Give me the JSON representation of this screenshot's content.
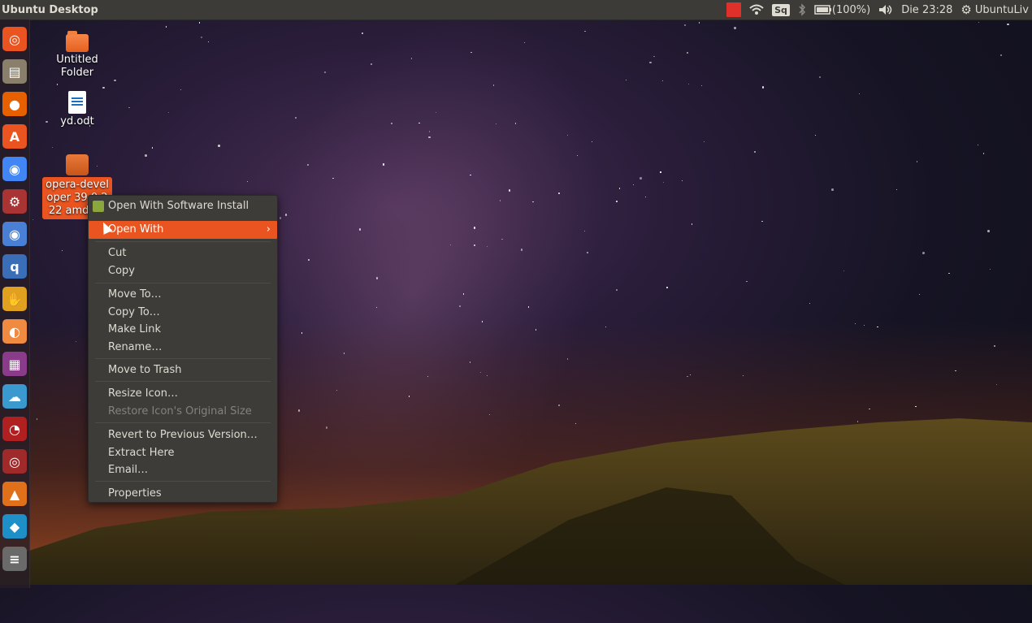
{
  "panel": {
    "title": "Ubuntu Desktop",
    "battery": "(100%)",
    "clock": "Die 23:28",
    "user": "UbuntuLiv",
    "indicator_sq": "Sq"
  },
  "desktop_icons": [
    {
      "label": "Untitled Folder",
      "type": "folder"
    },
    {
      "label": "yd.odt",
      "type": "document"
    },
    {
      "label": "opera-developer 39.0.222 amd64.",
      "type": "package"
    }
  ],
  "context_menu": {
    "items": [
      {
        "label": "Open With Software Install"
      },
      {
        "label": "Open With",
        "submenu": true,
        "highlighted": true
      },
      {
        "label": "Cut"
      },
      {
        "label": "Copy"
      },
      {
        "label": "Move To…"
      },
      {
        "label": "Copy To…"
      },
      {
        "label": "Make Link"
      },
      {
        "label": "Rename…"
      },
      {
        "label": "Move to Trash"
      },
      {
        "label": "Resize Icon…"
      },
      {
        "label": "Restore Icon's Original Size",
        "disabled": true
      },
      {
        "label": "Revert to Previous Version…"
      },
      {
        "label": "Extract Here"
      },
      {
        "label": "Email…"
      },
      {
        "label": "Properties"
      }
    ]
  },
  "launcher": {
    "items": [
      "dash-icon",
      "files-icon",
      "firefox-icon",
      "software-center-icon",
      "chrome-icon",
      "system-settings-icon",
      "chromium-icon",
      "qbittorrent-icon",
      "app-icon-yellow",
      "app-icon-orange",
      "app-icon-purple",
      "app-icon-cloud",
      "app-icon-red",
      "app-icon-red-dark",
      "vlc-icon",
      "kodi-icon",
      "app-icon-stack"
    ]
  },
  "colors": {
    "accent": "#e95420",
    "panel": "#3c3b37",
    "menu_bg": "#3d3c39"
  }
}
